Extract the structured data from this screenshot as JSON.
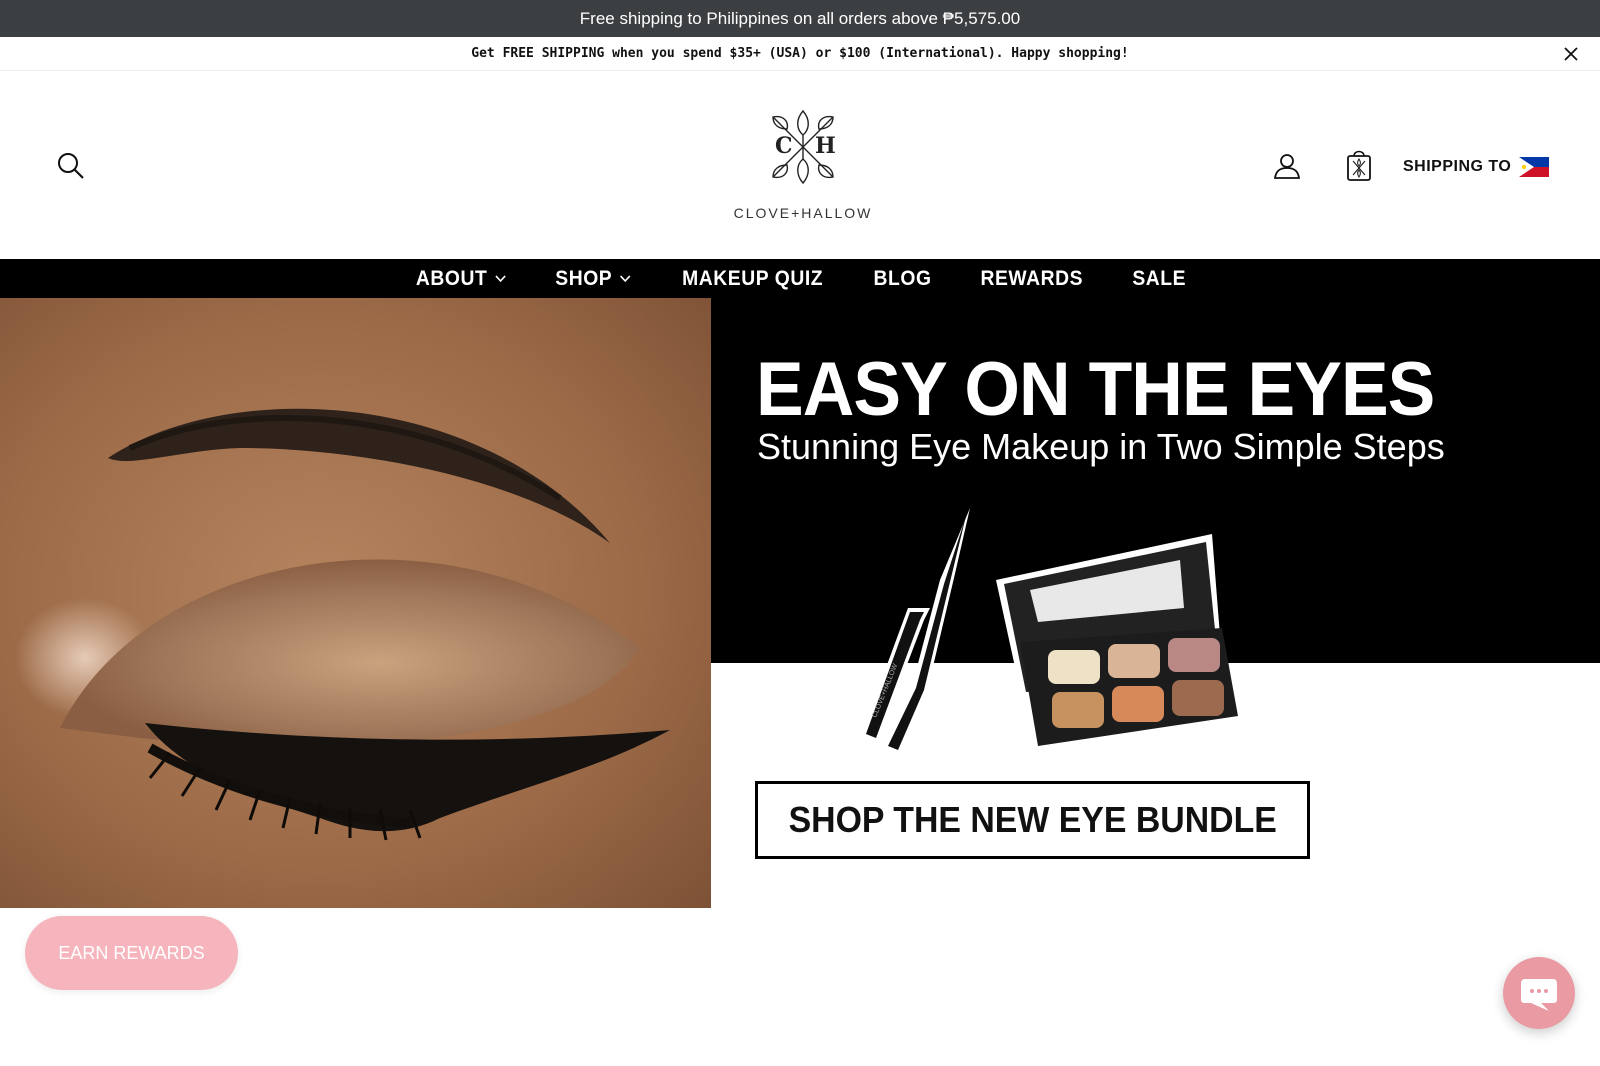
{
  "topbar": {
    "text": "Free shipping to Philippines on all orders above ₱5,575.00"
  },
  "promo": {
    "text": "Get FREE SHIPPING when you spend $35+ (USA) or $100 (International). Happy shopping!",
    "close_icon": "close-icon"
  },
  "header": {
    "logo_monogram_left": "C",
    "logo_monogram_right": "H",
    "logo_text": "CLOVE+HALLOW",
    "search_icon": "search-icon",
    "account_icon": "user-icon",
    "cart_icon": "shopping-bag-icon",
    "shipping_label": "SHIPPING TO",
    "shipping_flag": "philippines-flag-icon"
  },
  "nav": {
    "items": [
      {
        "label": "ABOUT",
        "has_dropdown": true
      },
      {
        "label": "SHOP",
        "has_dropdown": true
      },
      {
        "label": "MAKEUP QUIZ",
        "has_dropdown": false
      },
      {
        "label": "BLOG",
        "has_dropdown": false
      },
      {
        "label": "REWARDS",
        "has_dropdown": false
      },
      {
        "label": "SALE",
        "has_dropdown": false
      }
    ]
  },
  "hero": {
    "headline": "EASY ON THE EYES",
    "subhead": "Stunning Eye Makeup in Two Simple Steps",
    "cta_label": "SHOP THE NEW EYE BUNDLE",
    "eyeliner_brand": "CLOVE+HALLOW"
  },
  "widgets": {
    "earn_rewards": "EARN REWARDS",
    "chat_icon": "chat-bubble-icon"
  },
  "colors": {
    "topbar_bg": "#3b3f42",
    "nav_bg": "#000000",
    "earn_rewards_bg": "#f6b5bd",
    "chat_bg": "#e99aa3"
  }
}
